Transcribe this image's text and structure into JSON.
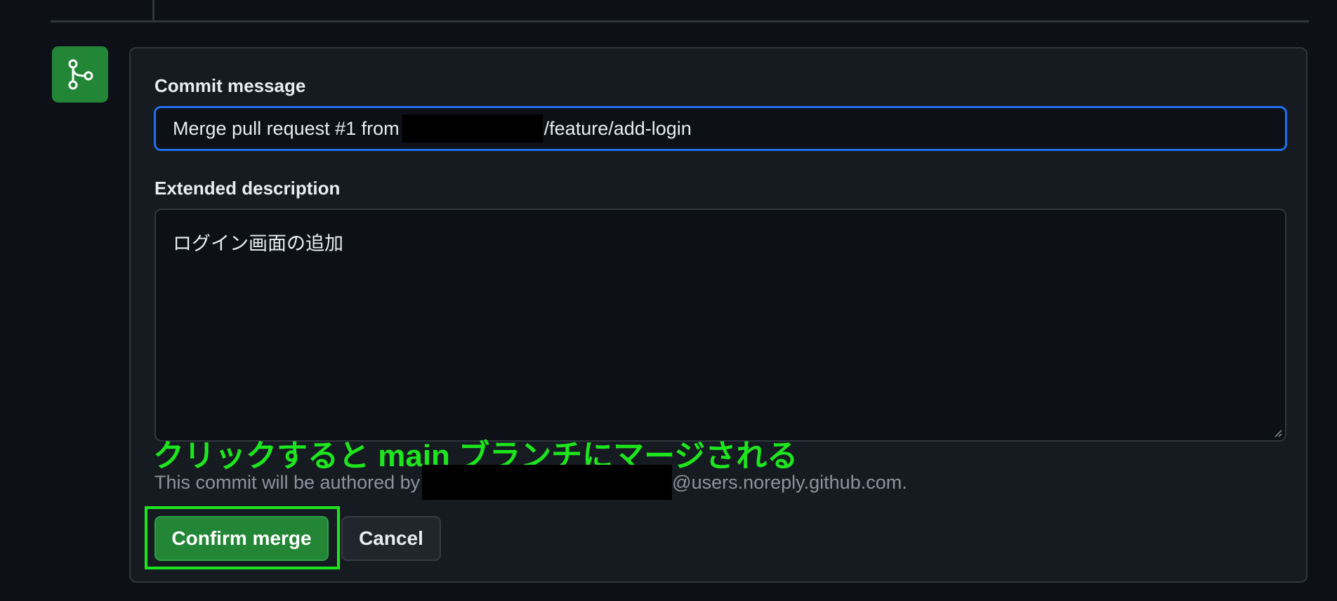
{
  "merge_form": {
    "commit_message_label": "Commit message",
    "commit_message_prefix": "Merge pull request #1 from",
    "commit_message_suffix": "/feature/add-login",
    "extended_description_label": "Extended description",
    "extended_description_value": "ログイン画面の追加",
    "author_note_prefix": "This commit will be authored by",
    "author_note_suffix": "@users.noreply.github.com.",
    "confirm_button_label": "Confirm merge",
    "cancel_button_label": "Cancel"
  },
  "annotation": {
    "text": "クリックすると main ブランチにマージされる",
    "color": "#1ee61e"
  },
  "icons": {
    "merge_badge": "git-merge-icon",
    "resize": "resize-grip-icon"
  },
  "colors": {
    "background": "#0d1117",
    "panel": "#161b22",
    "input_focus_border": "#1f6feb",
    "primary_button": "#238636",
    "muted_text": "#8b949e"
  }
}
